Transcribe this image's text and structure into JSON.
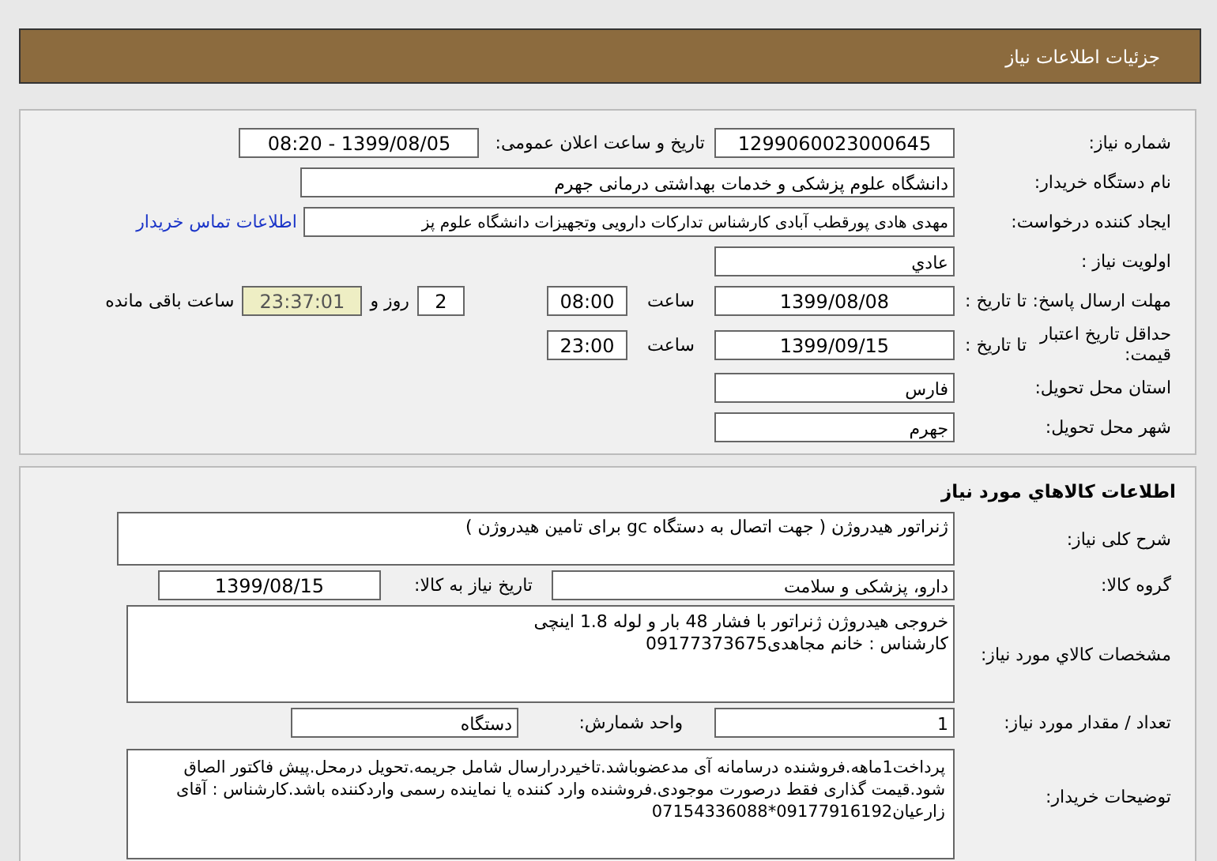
{
  "header": {
    "title": "جزئیات اطلاعات نیاز"
  },
  "need": {
    "number_label": "شماره نیاز:",
    "number": "1299060023000645",
    "announce_label": "تاریخ و ساعت اعلان عمومی:",
    "announce": "1399/08/05 - 08:20",
    "buyer_label": "نام دستگاه خریدار:",
    "buyer": "دانشگاه علوم پزشکی و خدمات بهداشتی درمانی جهرم",
    "requester_label": "ایجاد کننده درخواست:",
    "requester": "مهدی هادی پورقطب آبادی کارشناس تدارکات دارویی وتجهیزات دانشگاه علوم پز",
    "contact_link": "اطلاعات تماس خریدار",
    "priority_label": "اولویت نیاز :",
    "priority": "عادي",
    "deadline_label": "مهلت ارسال پاسخ:",
    "deadline_to": "تا تاریخ :",
    "deadline_date": "1399/08/08",
    "deadline_time_label": "ساعت",
    "deadline_time": "08:00",
    "days": "2",
    "days_label": "روز و",
    "remaining": "23:37:01",
    "remaining_label": "ساعت باقی مانده",
    "validity_label": "حداقل تاریخ اعتبار قیمت:",
    "validity_to": "تا تاریخ :",
    "validity_date": "1399/09/15",
    "validity_time_label": "ساعت",
    "validity_time": "23:00",
    "province_label": "استان محل تحویل:",
    "province": "فارس",
    "city_label": "شهر محل تحویل:",
    "city": "جهرم"
  },
  "goods": {
    "title": "اطلاعات کالاهاي مورد نیاز",
    "summary_label": "شرح کلی نیاز:",
    "summary": "ژنراتور هیدروژن ( جهت اتصال به دستگاه gc برای تامین هیدروژن )",
    "group_label": "گروه کالا:",
    "group": "دارو، پزشکی و سلامت",
    "need_date_label": "تاریخ نیاز به کالا:",
    "need_date": "1399/08/15",
    "specs_label": "مشخصات کالاي مورد نیاز:",
    "specs": [
      "خروجی هیدروژن ژنراتور با فشار 48 بار و لوله 1.8 اینچی",
      "کارشناس : خانم  مجاهدی09177373675"
    ],
    "quantity_label": "تعداد / مقدار مورد نیاز:",
    "quantity": "1",
    "unit_label": "واحد شمارش:",
    "unit": "دستگاه",
    "notes_label": "توضیحات خریدار:",
    "notes": "پرداخت1ماهه.فروشنده درسامانه آی مدعضوباشد.تاخیردرارسال شامل جریمه.تحویل درمحل.پیش فاکتور الصاق شود.قیمت گذاری فقط درصورت موجودی.فروشنده وارد کننده یا نماینده رسمی واردکننده باشد.کارشناس : آقای زارعیان09177916192*07154336088"
  }
}
